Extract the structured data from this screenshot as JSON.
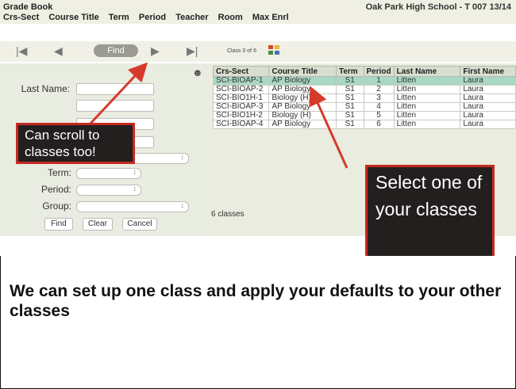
{
  "app": {
    "title": "Grade Book",
    "school": "Oak Park High School - T 007 13/14"
  },
  "menu": [
    "Crs-Sect",
    "Course Title",
    "Term",
    "Period",
    "Teacher",
    "Room",
    "Max Enrl"
  ],
  "toolbar": {
    "find_label": "Find",
    "class_counter": "Class 0 of 6"
  },
  "form": {
    "last_name_label": "Last Name:",
    "term_label": "Term:",
    "period_label": "Period:",
    "group_label": "Group:",
    "find_button": "Find",
    "clear_button": "Clear",
    "cancel_button": "Cancel"
  },
  "table": {
    "headers": [
      "Crs-Sect",
      "Course Title",
      "Term",
      "Period",
      "Last Name",
      "First Name"
    ],
    "rows": [
      [
        "SCI-BIOAP-1",
        "AP Biology",
        "S1",
        "1",
        "Litten",
        "Laura"
      ],
      [
        "SCI-BIOAP-2",
        "AP Biology",
        "S1",
        "2",
        "Litten",
        "Laura"
      ],
      [
        "SCI-BIO1H-1",
        "Biology (H)",
        "S1",
        "3",
        "Litten",
        "Laura"
      ],
      [
        "SCI-BIOAP-3",
        "AP Biology",
        "S1",
        "4",
        "Litten",
        "Laura"
      ],
      [
        "SCI-BIO1H-2",
        "Biology (H)",
        "S1",
        "5",
        "Litten",
        "Laura"
      ],
      [
        "SCI-BIOAP-4",
        "AP Biology",
        "S1",
        "6",
        "Litten",
        "Laura"
      ]
    ],
    "selected_row": 0,
    "count_label": "6 classes"
  },
  "callouts": {
    "scroll": "Can scroll to classes too!",
    "select": "Select one of your classes"
  },
  "caption": "We can set up one class and apply your defaults to your other classes",
  "colors": {
    "callout_bg": "#231f1f",
    "callout_border": "#c42b20",
    "selected_row": "#a9d8c4",
    "panel": "#e9ece1"
  },
  "icons": [
    "first-page-icon",
    "previous-icon",
    "next-icon",
    "last-page-icon",
    "grid-icon",
    "people-icon"
  ]
}
